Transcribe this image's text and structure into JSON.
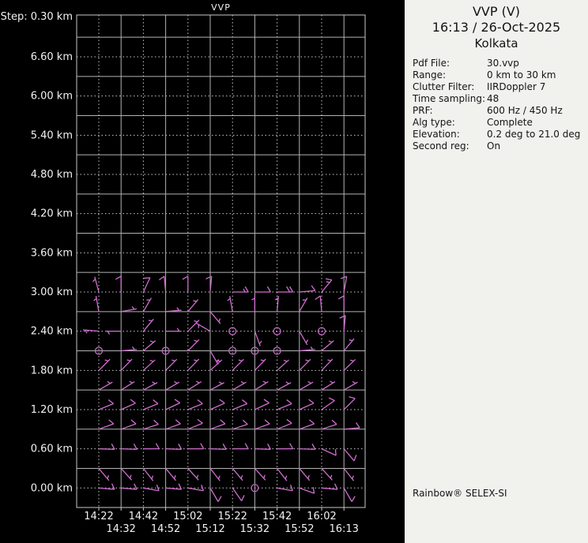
{
  "chart": {
    "title": "VVP",
    "step_label": "Step: 0.30 km"
  },
  "info_panel": {
    "title": "VVP (V)",
    "datetime": "16:13 / 26-Oct-2025",
    "site": "Kolkata",
    "fields": [
      {
        "label": "Pdf File:",
        "value": "30.vvp"
      },
      {
        "label": "Range:",
        "value": "0 km to 30 km"
      },
      {
        "label": "Clutter Filter:",
        "value": "IIRDoppler 7"
      },
      {
        "label": "Time sampling:",
        "value": "48"
      },
      {
        "label": "PRF:",
        "value": "600 Hz / 450 Hz"
      },
      {
        "label": "Alg type:",
        "value": "Complete"
      },
      {
        "label": "Elevation:",
        "value": "0.2 deg to 21.0 deg"
      },
      {
        "label": "Second reg:",
        "value": "On"
      }
    ],
    "footer": "Rainbow® SELEX-SI"
  },
  "chart_data": {
    "type": "wind-barb-time-height",
    "title": "VVP",
    "step_km": 0.3,
    "x_times": [
      "14:22",
      "14:32",
      "14:42",
      "14:52",
      "15:02",
      "15:12",
      "15:22",
      "15:32",
      "15:42",
      "15:52",
      "16:02",
      "16:13"
    ],
    "x_label_row1_indices": [
      0,
      2,
      4,
      6,
      8,
      10
    ],
    "x_label_row2_indices": [
      1,
      3,
      5,
      7,
      9,
      11
    ],
    "y_axis": {
      "labels": [
        "6.60 km",
        "6.00 km",
        "5.40 km",
        "4.80 km",
        "4.20 km",
        "3.60 km",
        "3.00 km",
        "2.40 km",
        "1.80 km",
        "1.20 km",
        "0.60 km",
        "0.00 km"
      ],
      "values_km": [
        6.6,
        6.0,
        5.4,
        4.8,
        4.2,
        3.6,
        3.0,
        2.4,
        1.8,
        1.2,
        0.6,
        0.0
      ],
      "solid_line_values_km": [
        6.9,
        6.3,
        5.7,
        5.1,
        4.5,
        3.9,
        3.3,
        2.7,
        2.1,
        1.5,
        0.9,
        0.3
      ],
      "range_km": [
        -0.3,
        7.25
      ]
    },
    "legend_note": "barb entries are [time_index, height_km, direction_deg_from, speed_kt]; speed 0 = calm circle",
    "barbs": [
      [
        0,
        3.0,
        345,
        5
      ],
      [
        1,
        3.0,
        0,
        10
      ],
      [
        2,
        3.0,
        25,
        10
      ],
      [
        3,
        3.0,
        355,
        10
      ],
      [
        4,
        3.0,
        0,
        10
      ],
      [
        5,
        3.0,
        5,
        10
      ],
      [
        6,
        3.0,
        90,
        15
      ],
      [
        7,
        3.0,
        90,
        10
      ],
      [
        8,
        3.0,
        90,
        20
      ],
      [
        9,
        3.0,
        85,
        10
      ],
      [
        10,
        3.0,
        40,
        15
      ],
      [
        11,
        3.0,
        10,
        10
      ],
      [
        0,
        2.7,
        350,
        5
      ],
      [
        1,
        2.7,
        80,
        5
      ],
      [
        2,
        2.7,
        30,
        5
      ],
      [
        3,
        2.7,
        85,
        5
      ],
      [
        4,
        2.7,
        40,
        5
      ],
      [
        5,
        2.7,
        140,
        5
      ],
      [
        6,
        2.7,
        350,
        5
      ],
      [
        7,
        2.7,
        0,
        5
      ],
      [
        8,
        2.7,
        5,
        5
      ],
      [
        9,
        2.7,
        30,
        5
      ],
      [
        10,
        2.7,
        355,
        10
      ],
      [
        11,
        2.7,
        0,
        10
      ],
      [
        0,
        2.4,
        275,
        5
      ],
      [
        1,
        2.4,
        270,
        5
      ],
      [
        2,
        2.4,
        40,
        5
      ],
      [
        3,
        2.4,
        90,
        5
      ],
      [
        4,
        2.4,
        45,
        5
      ],
      [
        5,
        2.4,
        300,
        5
      ],
      [
        6,
        2.4,
        0,
        0
      ],
      [
        7,
        2.4,
        160,
        5
      ],
      [
        8,
        2.4,
        0,
        0
      ],
      [
        9,
        2.4,
        150,
        5
      ],
      [
        10,
        2.4,
        0,
        0
      ],
      [
        11,
        2.4,
        5,
        10
      ],
      [
        0,
        2.1,
        0,
        0
      ],
      [
        1,
        2.1,
        85,
        5
      ],
      [
        2,
        2.1,
        50,
        5
      ],
      [
        3,
        2.1,
        0,
        0
      ],
      [
        4,
        2.1,
        45,
        5
      ],
      [
        5,
        2.1,
        150,
        5
      ],
      [
        6,
        2.1,
        0,
        0
      ],
      [
        7,
        2.1,
        0,
        0
      ],
      [
        8,
        2.1,
        0,
        0
      ],
      [
        9,
        2.1,
        85,
        5
      ],
      [
        10,
        2.1,
        50,
        5
      ],
      [
        11,
        2.1,
        40,
        5
      ],
      [
        0,
        1.8,
        45,
        5
      ],
      [
        1,
        1.8,
        44,
        5
      ],
      [
        2,
        1.8,
        48,
        5
      ],
      [
        3,
        1.8,
        45,
        5
      ],
      [
        4,
        1.8,
        44,
        5
      ],
      [
        5,
        1.8,
        48,
        5
      ],
      [
        6,
        1.8,
        45,
        5
      ],
      [
        7,
        1.8,
        44,
        5
      ],
      [
        8,
        1.8,
        48,
        5
      ],
      [
        9,
        1.8,
        45,
        5
      ],
      [
        10,
        1.8,
        44,
        5
      ],
      [
        11,
        1.8,
        46,
        5
      ],
      [
        0,
        1.5,
        60,
        5
      ],
      [
        1,
        1.5,
        58,
        5
      ],
      [
        2,
        1.5,
        62,
        5
      ],
      [
        3,
        1.5,
        60,
        5
      ],
      [
        4,
        1.5,
        58,
        5
      ],
      [
        5,
        1.5,
        62,
        5
      ],
      [
        6,
        1.5,
        60,
        5
      ],
      [
        7,
        1.5,
        58,
        5
      ],
      [
        8,
        1.5,
        62,
        5
      ],
      [
        9,
        1.5,
        60,
        5
      ],
      [
        10,
        1.5,
        58,
        5
      ],
      [
        11,
        1.5,
        60,
        5
      ],
      [
        0,
        1.2,
        68,
        10
      ],
      [
        1,
        1.2,
        66,
        10
      ],
      [
        2,
        1.2,
        68,
        10
      ],
      [
        3,
        1.2,
        65,
        10
      ],
      [
        4,
        1.2,
        68,
        10
      ],
      [
        5,
        1.2,
        66,
        10
      ],
      [
        6,
        1.2,
        68,
        10
      ],
      [
        7,
        1.2,
        65,
        10
      ],
      [
        8,
        1.2,
        68,
        10
      ],
      [
        9,
        1.2,
        66,
        10
      ],
      [
        10,
        1.2,
        55,
        10
      ],
      [
        11,
        1.2,
        45,
        10
      ],
      [
        0,
        0.9,
        70,
        10
      ],
      [
        1,
        0.9,
        70,
        10
      ],
      [
        2,
        0.9,
        72,
        10
      ],
      [
        3,
        0.9,
        70,
        10
      ],
      [
        4,
        0.9,
        68,
        10
      ],
      [
        5,
        0.9,
        70,
        10
      ],
      [
        6,
        0.9,
        72,
        10
      ],
      [
        7,
        0.9,
        70,
        10
      ],
      [
        8,
        0.9,
        68,
        10
      ],
      [
        9,
        0.9,
        70,
        10
      ],
      [
        10,
        0.9,
        72,
        10
      ],
      [
        11,
        0.9,
        85,
        10
      ],
      [
        0,
        0.6,
        92,
        10
      ],
      [
        1,
        0.6,
        92,
        10
      ],
      [
        2,
        0.6,
        90,
        10
      ],
      [
        3,
        0.6,
        92,
        10
      ],
      [
        4,
        0.6,
        90,
        10
      ],
      [
        5,
        0.6,
        92,
        10
      ],
      [
        6,
        0.6,
        90,
        10
      ],
      [
        7,
        0.6,
        92,
        10
      ],
      [
        8,
        0.6,
        90,
        10
      ],
      [
        9,
        0.6,
        92,
        10
      ],
      [
        10,
        0.6,
        115,
        10
      ],
      [
        11,
        0.6,
        140,
        10
      ],
      [
        0,
        0.3,
        140,
        5
      ],
      [
        1,
        0.3,
        138,
        5
      ],
      [
        2,
        0.3,
        142,
        5
      ],
      [
        3,
        0.3,
        140,
        5
      ],
      [
        4,
        0.3,
        138,
        5
      ],
      [
        5,
        0.3,
        142,
        5
      ],
      [
        6,
        0.3,
        140,
        5
      ],
      [
        7,
        0.3,
        138,
        5
      ],
      [
        8,
        0.3,
        142,
        5
      ],
      [
        9,
        0.3,
        140,
        5
      ],
      [
        10,
        0.3,
        138,
        5
      ],
      [
        11,
        0.3,
        142,
        5
      ],
      [
        0,
        0.0,
        95,
        10
      ],
      [
        1,
        0.0,
        95,
        10
      ],
      [
        2,
        0.0,
        100,
        10
      ],
      [
        3,
        0.0,
        95,
        10
      ],
      [
        4,
        0.0,
        100,
        10
      ],
      [
        5,
        0.0,
        150,
        10
      ],
      [
        6,
        0.0,
        145,
        10
      ],
      [
        7,
        0.0,
        0,
        0
      ],
      [
        8,
        0.0,
        100,
        10
      ],
      [
        9,
        0.0,
        110,
        10
      ],
      [
        10,
        0.0,
        95,
        10
      ],
      [
        11,
        0.0,
        150,
        10
      ]
    ],
    "colors": {
      "background": "#000000",
      "barb": "#d06ed0",
      "grid_solid": "#b2b2b2",
      "grid_dotted": "#c9c9c9",
      "axis_text": "#f2f2f2",
      "panel_bg": "#f1f1ee",
      "panel_text": "#141414"
    }
  }
}
